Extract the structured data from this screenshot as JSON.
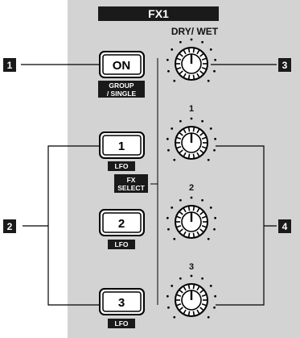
{
  "panel": {
    "title": "FX1",
    "dry_wet_label": "DRY/ WET",
    "group_single_label_1": "GROUP",
    "group_single_label_2": "/ SINGLE",
    "fx_select_label_1": "FX",
    "fx_select_label_2": "SELECT",
    "on_button_label": "ON",
    "param_buttons": [
      {
        "label": "1",
        "sub": "LFO"
      },
      {
        "label": "2",
        "sub": "LFO"
      },
      {
        "label": "3",
        "sub": "LFO"
      }
    ],
    "knob_labels": [
      "1",
      "2",
      "3"
    ]
  },
  "callouts": [
    "1",
    "2",
    "3",
    "4"
  ],
  "colors": {
    "panel_bg": "#d3d3d3",
    "label_bg": "#1a1a1a",
    "callout_bg": "#1a1a1a",
    "line": "#000000"
  }
}
